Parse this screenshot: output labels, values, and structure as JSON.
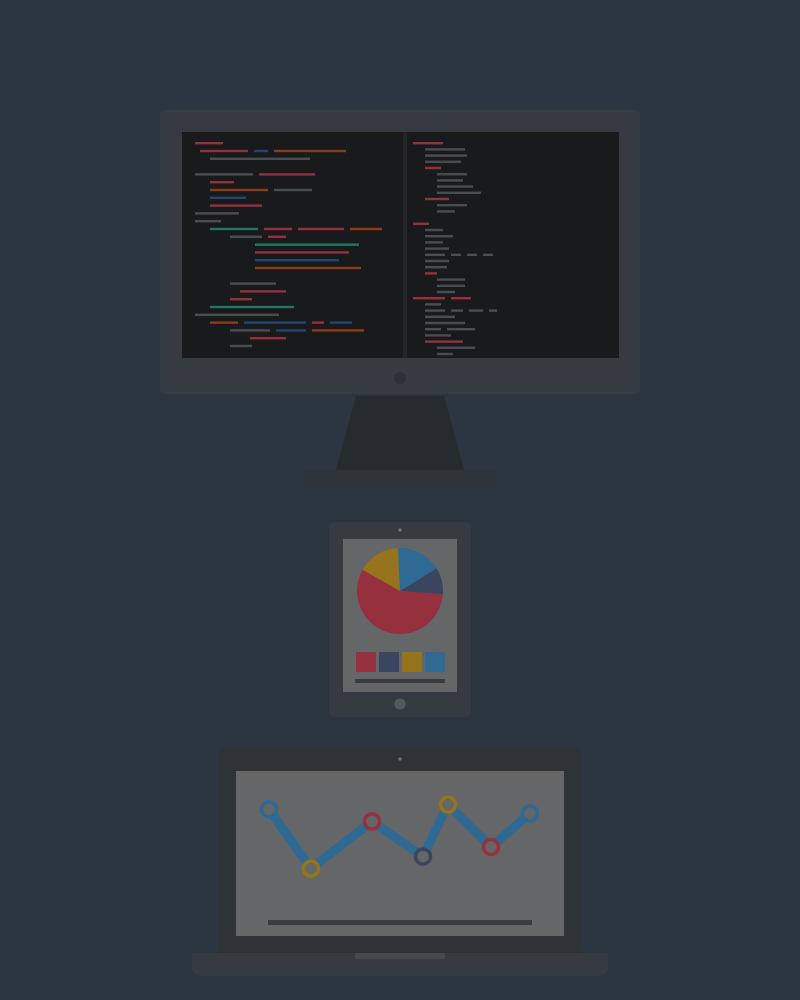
{
  "theme": {
    "background": "#2c3641",
    "device_body": "#353b40",
    "device_bezel": "#2e3337",
    "stand": "#262b2e",
    "editor_bg": "#181a1b",
    "editor_divider": "#232627",
    "screen_light": "#646668",
    "line_dark": "#3a3d3f"
  },
  "palette": {
    "red": "#95303e",
    "slate": "#3a4660",
    "gold": "#96741d",
    "blue": "#2e6a94",
    "teal": "#237664",
    "orange": "#8f3a1a",
    "gray": "#4a4d50",
    "navy": "#23456e"
  },
  "icons": {
    "monitor": "monitor-icon",
    "tablet": "tablet-icon",
    "laptop": "laptop-icon"
  },
  "monitor_code": {
    "left_lines": [
      [
        {
          "c": "red",
          "w": 28
        }
      ],
      [
        {
          "c": "red",
          "w": 48
        },
        {
          "c": "navy",
          "w": 14
        },
        {
          "c": "orange",
          "w": 72
        }
      ],
      [
        {
          "c": "gray",
          "w": 100
        }
      ],
      [],
      [
        {
          "c": "gray",
          "w": 58
        },
        {
          "c": "red",
          "w": 56
        }
      ],
      [
        {
          "c": "red",
          "w": 24
        }
      ],
      [
        {
          "c": "orange",
          "w": 58
        },
        {
          "c": "gray",
          "w": 38
        }
      ],
      [
        {
          "c": "navy",
          "w": 36
        }
      ],
      [
        {
          "c": "red",
          "w": 52
        }
      ],
      [
        {
          "c": "gray",
          "w": 44
        }
      ],
      [
        {
          "c": "gray",
          "w": 26
        }
      ],
      [
        {
          "c": "teal",
          "w": 48
        },
        {
          "c": "red",
          "w": 28
        },
        {
          "c": "red",
          "w": 46
        },
        {
          "c": "orange",
          "w": 32
        }
      ],
      [
        {
          "c": "gray",
          "w": 32
        },
        {
          "c": "red",
          "w": 18
        }
      ],
      [
        {
          "c": "teal",
          "w": 104
        }
      ],
      [
        {
          "c": "red",
          "w": 94
        }
      ],
      [
        {
          "c": "navy",
          "w": 84
        }
      ],
      [
        {
          "c": "orange",
          "w": 106
        }
      ],
      [],
      [
        {
          "c": "gray",
          "w": 46
        }
      ],
      [
        {
          "c": "red",
          "w": 46
        }
      ],
      [
        {
          "c": "red",
          "w": 22
        }
      ],
      [
        {
          "c": "teal",
          "w": 84
        }
      ],
      [
        {
          "c": "gray",
          "w": 84
        }
      ],
      [
        {
          "c": "orange",
          "w": 28
        },
        {
          "c": "navy",
          "w": 62
        },
        {
          "c": "red",
          "w": 12
        },
        {
          "c": "navy",
          "w": 22
        }
      ],
      [
        {
          "c": "gray",
          "w": 40
        },
        {
          "c": "navy",
          "w": 30
        },
        {
          "c": "orange",
          "w": 52
        }
      ],
      [
        {
          "c": "red",
          "w": 36
        }
      ],
      [
        {
          "c": "gray",
          "w": 22
        }
      ]
    ],
    "left_indent": [
      0,
      1,
      3,
      0,
      0,
      3,
      3,
      3,
      3,
      0,
      0,
      3,
      7,
      12,
      12,
      12,
      12,
      0,
      7,
      9,
      7,
      3,
      0,
      3,
      7,
      11,
      7
    ],
    "right_lines": [
      [
        {
          "c": "red",
          "w": 30
        }
      ],
      [
        {
          "c": "gray",
          "w": 40
        }
      ],
      [
        {
          "c": "gray",
          "w": 42
        }
      ],
      [
        {
          "c": "gray",
          "w": 36
        }
      ],
      [
        {
          "c": "red",
          "w": 16
        }
      ],
      [
        {
          "c": "gray",
          "w": 30
        }
      ],
      [
        {
          "c": "gray",
          "w": 26
        }
      ],
      [
        {
          "c": "gray",
          "w": 36
        }
      ],
      [
        {
          "c": "gray",
          "w": 44
        }
      ],
      [
        {
          "c": "red",
          "w": 24
        }
      ],
      [
        {
          "c": "gray",
          "w": 30
        }
      ],
      [
        {
          "c": "gray",
          "w": 18
        }
      ],
      [],
      [
        {
          "c": "red",
          "w": 16
        }
      ],
      [
        {
          "c": "gray",
          "w": 18
        }
      ],
      [
        {
          "c": "gray",
          "w": 28
        }
      ],
      [
        {
          "c": "gray",
          "w": 18
        }
      ],
      [
        {
          "c": "gray",
          "w": 24
        }
      ],
      [
        {
          "c": "gray",
          "w": 20
        },
        {
          "c": "gray",
          "w": 10
        },
        {
          "c": "gray",
          "w": 10
        },
        {
          "c": "gray",
          "w": 10
        }
      ],
      [
        {
          "c": "gray",
          "w": 24
        }
      ],
      [
        {
          "c": "gray",
          "w": 22
        }
      ],
      [
        {
          "c": "red",
          "w": 12
        }
      ],
      [
        {
          "c": "gray",
          "w": 28
        }
      ],
      [
        {
          "c": "gray",
          "w": 28
        }
      ],
      [
        {
          "c": "gray",
          "w": 18
        }
      ],
      [
        {
          "c": "red",
          "w": 32
        },
        {
          "c": "red",
          "w": 20
        }
      ],
      [
        {
          "c": "gray",
          "w": 16
        }
      ],
      [
        {
          "c": "gray",
          "w": 20
        },
        {
          "c": "gray",
          "w": 12
        },
        {
          "c": "gray",
          "w": 14
        },
        {
          "c": "gray",
          "w": 8
        }
      ],
      [
        {
          "c": "gray",
          "w": 30
        }
      ],
      [
        {
          "c": "gray",
          "w": 40
        }
      ],
      [
        {
          "c": "gray",
          "w": 16
        },
        {
          "c": "gray",
          "w": 28
        }
      ],
      [
        {
          "c": "gray",
          "w": 26
        }
      ],
      [
        {
          "c": "red",
          "w": 38
        }
      ],
      [
        {
          "c": "gray",
          "w": 38
        }
      ],
      [
        {
          "c": "gray",
          "w": 16
        }
      ]
    ],
    "right_indent": [
      0,
      2,
      2,
      2,
      2,
      4,
      4,
      4,
      4,
      2,
      4,
      4,
      0,
      0,
      2,
      2,
      2,
      2,
      2,
      2,
      2,
      2,
      4,
      4,
      4,
      0,
      2,
      2,
      2,
      2,
      2,
      2,
      2,
      4,
      4
    ]
  },
  "tablet_chart": {
    "slices": [
      {
        "color": "blue",
        "value": 17
      },
      {
        "color": "slate",
        "value": 10
      },
      {
        "color": "red",
        "value": 57
      },
      {
        "color": "gold",
        "value": 16
      }
    ],
    "swatches": [
      "red",
      "slate",
      "gold",
      "blue"
    ]
  },
  "laptop_chart": {
    "values": [
      0.92,
      0.18,
      0.77,
      0.33,
      0.98,
      0.45,
      0.87
    ],
    "ring_colors": [
      "blue",
      "gold",
      "red",
      "slate",
      "gold",
      "red",
      "blue"
    ]
  }
}
